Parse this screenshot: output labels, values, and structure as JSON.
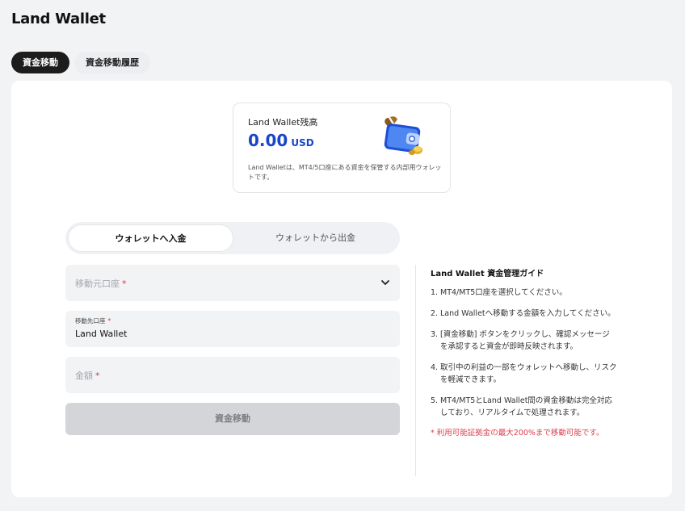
{
  "app": {
    "title": "Land Wallet"
  },
  "top_tabs": [
    {
      "label": "資金移動",
      "active": true
    },
    {
      "label": "資金移動履歴",
      "active": false
    }
  ],
  "balance": {
    "label": "Land Wallet残高",
    "value": "0.00",
    "currency": "USD",
    "note": "Land Walletは、MT4/5口座にある資金を保管する内部用ウォレットです。",
    "icon": "wallet-icon"
  },
  "mode_tabs": [
    {
      "label": "ウォレットへ入金",
      "active": true
    },
    {
      "label": "ウォレットから出金",
      "active": false
    }
  ],
  "form": {
    "source_account": {
      "placeholder": "移動元口座",
      "required_mark": "*"
    },
    "destination_account": {
      "label": "移動先口座",
      "required_mark": "*",
      "value": "Land Wallet"
    },
    "amount": {
      "placeholder": "金額",
      "required_mark": "*"
    },
    "submit_label": "資金移動"
  },
  "guide": {
    "title": "Land Wallet 資金管理ガイド",
    "items": [
      {
        "num": "1.",
        "text": "MT4/MT5口座を選択してください。"
      },
      {
        "num": "2.",
        "text": "Land Walletへ移動する金額を入力してください。"
      },
      {
        "num": "3.",
        "text": "[資金移動] ボタンをクリックし、確認メッセージを承認すると資金が即時反映されます。"
      },
      {
        "num": "4.",
        "text": "取引中の利益の一部をウォレットへ移動し、リスクを軽減できます。"
      },
      {
        "num": "5.",
        "text": "MT4/MT5とLand Wallet間の資金移動は完全対応しており、リアルタイムで処理されます。"
      }
    ],
    "warning": "* 利用可能証拠金の最大200%まで移動可能です。"
  },
  "colors": {
    "accent": "#1846c8",
    "active_tab_bg": "#1c1c1c",
    "warning": "#e03a4a",
    "disabled_button": "#d4d5d8"
  }
}
